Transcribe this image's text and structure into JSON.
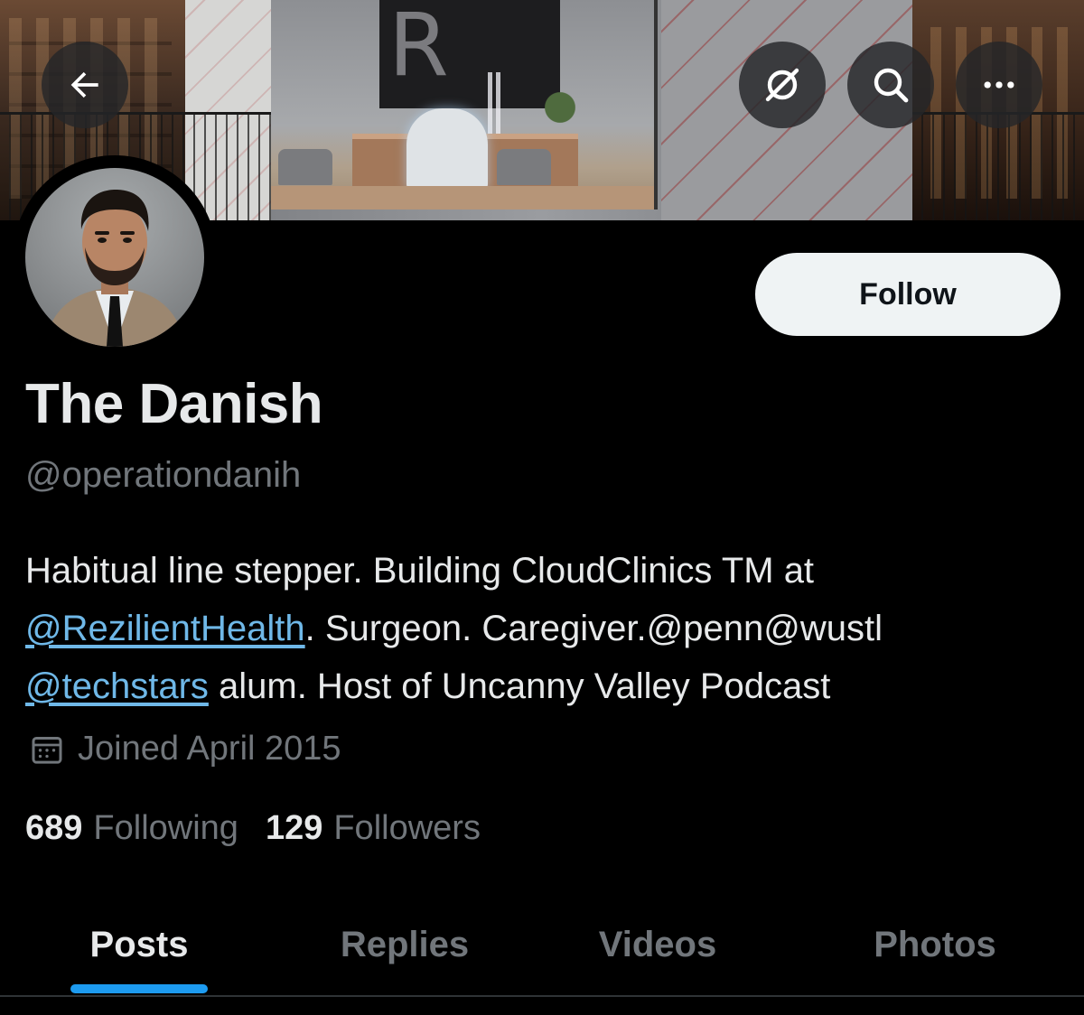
{
  "header": {
    "back_icon": "arrow-left-icon",
    "grok_icon": "grok-icon",
    "search_icon": "search-icon",
    "more_icon": "more-horizontal-icon"
  },
  "profile": {
    "display_name": "The Danish",
    "handle": "@operationdanih",
    "follow_label": "Follow",
    "bio": {
      "line1": "Habitual line stepper. Building CloudClinics TM at",
      "mention_rezilient": "@RezilientHealth",
      "line2_rest": ". Surgeon. Caregiver.@penn@wustl",
      "mention_techstars": "@techstars",
      "line3_rest": " alum. Host of Uncanny Valley Podcast"
    },
    "joined": "Joined April 2015",
    "following_count": "689",
    "following_label": "Following",
    "followers_count": "129",
    "followers_label": "Followers"
  },
  "tabs": [
    {
      "label": "Posts",
      "active": true
    },
    {
      "label": "Replies",
      "active": false
    },
    {
      "label": "Videos",
      "active": false
    },
    {
      "label": "Photos",
      "active": false
    }
  ],
  "colors": {
    "background": "#000000",
    "text_primary": "#e7e9ea",
    "text_secondary": "#71767b",
    "link": "#6fb8e8",
    "accent": "#1d9bf0",
    "follow_bg": "#eff3f4"
  }
}
